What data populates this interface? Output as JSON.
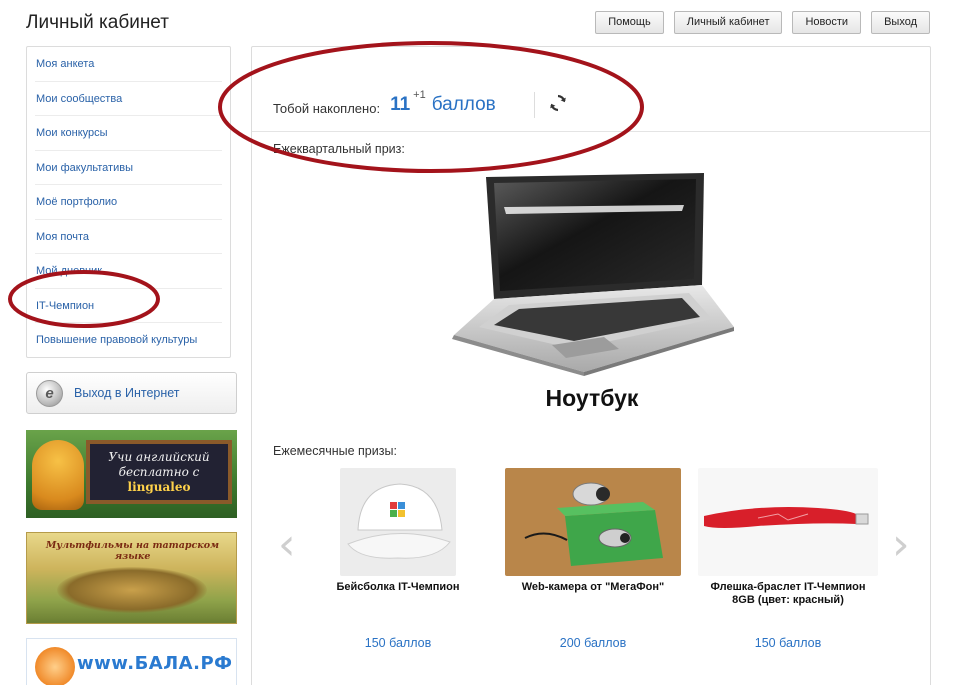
{
  "header": {
    "title": "Личный кабинет",
    "nav": [
      "Помощь",
      "Личный кабинет",
      "Новости",
      "Выход"
    ]
  },
  "sidebar": {
    "items": [
      "Моя анкета",
      "Мои сообщества",
      "Мои конкурсы",
      "Мои факультативы",
      "Моё портфолио",
      "Моя почта",
      "Мой дневник",
      "IT-Чемпион",
      "Повышение правовой культуры"
    ],
    "internet_button": "Выход в Интернет"
  },
  "banners": {
    "lingualeo_line1": "Учи английский",
    "lingualeo_line2": "бесплатно с",
    "lingualeo_brand": "lingualeo",
    "cartoons": "Мультфильмы на татарском языке",
    "bala": "www.БАЛА.РФ"
  },
  "main": {
    "points_label": "Тобой накоплено:",
    "points_value": "11",
    "points_delta": "+1",
    "points_unit": "баллов",
    "quarterly_label": "Ежеквартальный приз:",
    "quarterly_prize": "Ноутбук",
    "monthly_label": "Ежемесячные призы:",
    "monthly_prizes": [
      {
        "name": "Бейсболка IT-Чемпион",
        "price": "150 баллов"
      },
      {
        "name": "Web-камера от \"МегаФон\"",
        "price": "200 баллов"
      },
      {
        "name": "Флешка-браслет IT-Чемпион 8GB (цвет: красный)",
        "price": "150 баллов"
      }
    ]
  },
  "icons": {
    "refresh": "refresh-icon",
    "arrow_left": "chevron-left-icon",
    "arrow_right": "chevron-right-icon",
    "browser": "internet-explorer-icon"
  },
  "colors": {
    "link": "#2a62a8",
    "accent": "#2a72c4",
    "annotation": "#a3131b"
  }
}
